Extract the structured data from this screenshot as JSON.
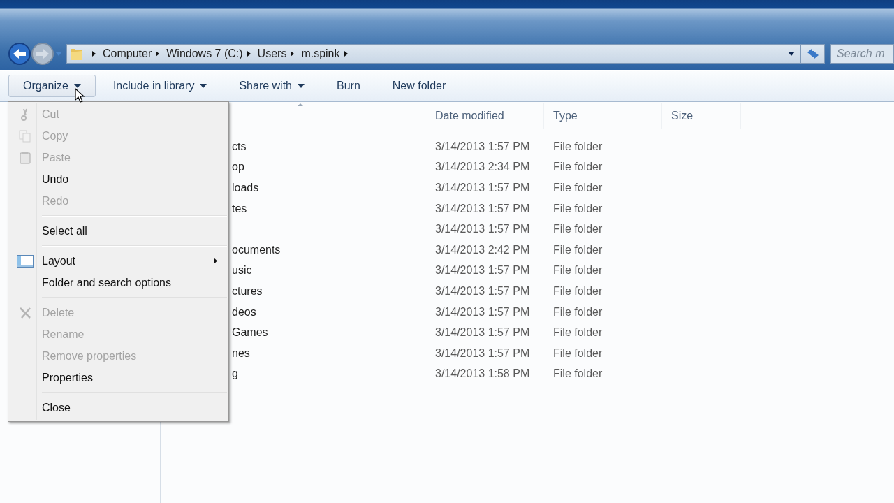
{
  "address": {
    "crumbs": [
      "Computer",
      "Windows 7 (C:)",
      "Users",
      "m.spink"
    ]
  },
  "search": {
    "placeholder": "Search m"
  },
  "toolbar": [
    {
      "label": "Organize",
      "dropdown": true,
      "selected": true
    },
    {
      "label": "Include in library",
      "dropdown": true,
      "selected": false
    },
    {
      "label": "Share with",
      "dropdown": true,
      "selected": false
    },
    {
      "label": "Burn",
      "dropdown": false,
      "selected": false
    },
    {
      "label": "New folder",
      "dropdown": false,
      "selected": false
    }
  ],
  "columns": [
    "Date modified",
    "Type",
    "Size"
  ],
  "rows": [
    {
      "name": "cts",
      "date": "3/14/2013 1:57 PM",
      "type": "File folder"
    },
    {
      "name": "op",
      "date": "3/14/2013 2:34 PM",
      "type": "File folder"
    },
    {
      "name": "loads",
      "date": "3/14/2013 1:57 PM",
      "type": "File folder"
    },
    {
      "name": "tes",
      "date": "3/14/2013 1:57 PM",
      "type": "File folder"
    },
    {
      "date": "3/14/2013 1:57 PM",
      "type": "File folder"
    },
    {
      "name": "ocuments",
      "date": "3/14/2013 2:42 PM",
      "type": "File folder"
    },
    {
      "name": "usic",
      "date": "3/14/2013 1:57 PM",
      "type": "File folder"
    },
    {
      "name": "ctures",
      "date": "3/14/2013 1:57 PM",
      "type": "File folder"
    },
    {
      "name": "deos",
      "date": "3/14/2013 1:57 PM",
      "type": "File folder"
    },
    {
      "name": "Games",
      "date": "3/14/2013 1:57 PM",
      "type": "File folder"
    },
    {
      "name": "nes",
      "date": "3/14/2013 1:57 PM",
      "type": "File folder"
    },
    {
      "name": "g",
      "date": "3/14/2013 1:58 PM",
      "type": "File folder"
    }
  ],
  "menu": [
    [
      {
        "label": "Cut",
        "disabled": true,
        "submenu": false
      },
      {
        "label": "Copy",
        "disabled": true,
        "submenu": false
      },
      {
        "label": "Paste",
        "disabled": true,
        "submenu": false
      },
      {
        "label": "Undo",
        "disabled": false,
        "submenu": false
      },
      {
        "label": "Redo",
        "disabled": true,
        "submenu": false
      }
    ],
    [
      {
        "label": "Select all",
        "disabled": false,
        "submenu": false
      }
    ],
    [
      {
        "label": "Layout",
        "disabled": false,
        "submenu": true
      },
      {
        "label": "Folder and search options",
        "disabled": false,
        "submenu": false
      }
    ],
    [
      {
        "label": "Delete",
        "disabled": true,
        "submenu": false
      },
      {
        "label": "Rename",
        "disabled": true,
        "submenu": false
      },
      {
        "label": "Remove properties",
        "disabled": true,
        "submenu": false
      },
      {
        "label": "Properties",
        "disabled": false,
        "submenu": false
      }
    ],
    [
      {
        "label": "Close",
        "disabled": false,
        "submenu": false
      }
    ]
  ]
}
